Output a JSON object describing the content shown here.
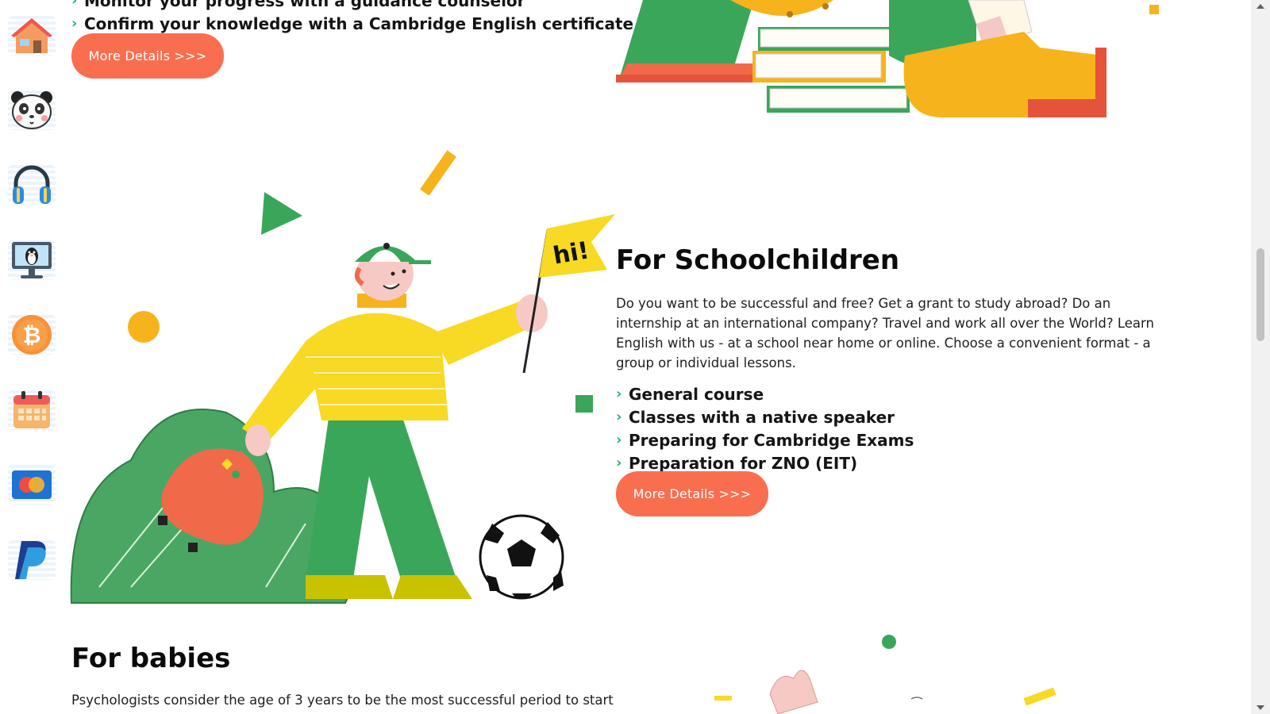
{
  "sidebar": {
    "items": [
      {
        "icon": "home-icon"
      },
      {
        "icon": "panda-icon"
      },
      {
        "icon": "headphones-icon"
      },
      {
        "icon": "penguin-monitor-icon"
      },
      {
        "icon": "bitcoin-icon"
      },
      {
        "icon": "calendar-icon"
      },
      {
        "icon": "mastercard-icon"
      },
      {
        "icon": "paypal-icon"
      }
    ]
  },
  "section_top": {
    "items": [
      "Monitor your progress with a guidance counselor",
      "Confirm your knowledge with a Cambridge English certificate"
    ],
    "button_label": "More Details >>>"
  },
  "section_schoolchildren": {
    "title": "For Schoolchildren",
    "description": "Do you want to be successful and free? Get a grant to study abroad? Do an internship at an international company? Travel and work all over the World? Learn English with us - at a school near home or online. Choose a convenient format - a group or individual lessons.",
    "items": [
      "General course",
      "Classes with a native speaker",
      "Preparing for Cambridge Exams",
      "Preparation for ZNO (EIT)"
    ],
    "button_label": "More Details >>>",
    "flag_text": "hi!"
  },
  "section_babies": {
    "title": "For babies",
    "description_start": "Psychologists consider the age of 3 years to be the most successful period to start"
  },
  "colors": {
    "accent": "#fa6e50",
    "check": "#1fb37a",
    "green": "#3aa65a",
    "yellow": "#f8d923",
    "orange": "#f6b31c"
  }
}
